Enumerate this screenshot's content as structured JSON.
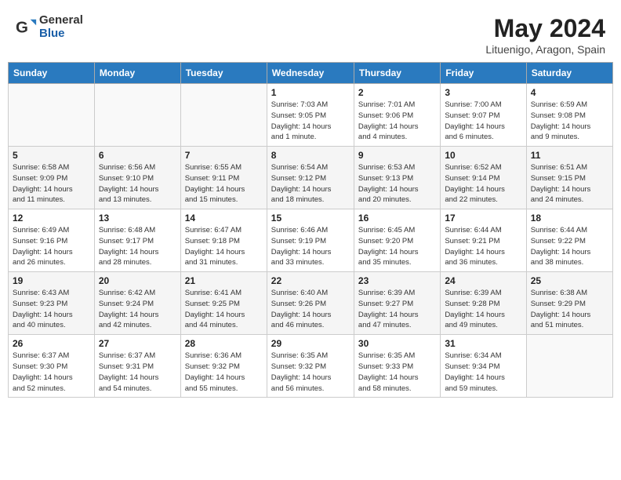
{
  "header": {
    "logo_general": "General",
    "logo_blue": "Blue",
    "title": "May 2024",
    "location": "Lituenigo, Aragon, Spain"
  },
  "weekdays": [
    "Sunday",
    "Monday",
    "Tuesday",
    "Wednesday",
    "Thursday",
    "Friday",
    "Saturday"
  ],
  "weeks": [
    [
      {
        "day": "",
        "info": ""
      },
      {
        "day": "",
        "info": ""
      },
      {
        "day": "",
        "info": ""
      },
      {
        "day": "1",
        "info": "Sunrise: 7:03 AM\nSunset: 9:05 PM\nDaylight: 14 hours\nand 1 minute."
      },
      {
        "day": "2",
        "info": "Sunrise: 7:01 AM\nSunset: 9:06 PM\nDaylight: 14 hours\nand 4 minutes."
      },
      {
        "day": "3",
        "info": "Sunrise: 7:00 AM\nSunset: 9:07 PM\nDaylight: 14 hours\nand 6 minutes."
      },
      {
        "day": "4",
        "info": "Sunrise: 6:59 AM\nSunset: 9:08 PM\nDaylight: 14 hours\nand 9 minutes."
      }
    ],
    [
      {
        "day": "5",
        "info": "Sunrise: 6:58 AM\nSunset: 9:09 PM\nDaylight: 14 hours\nand 11 minutes."
      },
      {
        "day": "6",
        "info": "Sunrise: 6:56 AM\nSunset: 9:10 PM\nDaylight: 14 hours\nand 13 minutes."
      },
      {
        "day": "7",
        "info": "Sunrise: 6:55 AM\nSunset: 9:11 PM\nDaylight: 14 hours\nand 15 minutes."
      },
      {
        "day": "8",
        "info": "Sunrise: 6:54 AM\nSunset: 9:12 PM\nDaylight: 14 hours\nand 18 minutes."
      },
      {
        "day": "9",
        "info": "Sunrise: 6:53 AM\nSunset: 9:13 PM\nDaylight: 14 hours\nand 20 minutes."
      },
      {
        "day": "10",
        "info": "Sunrise: 6:52 AM\nSunset: 9:14 PM\nDaylight: 14 hours\nand 22 minutes."
      },
      {
        "day": "11",
        "info": "Sunrise: 6:51 AM\nSunset: 9:15 PM\nDaylight: 14 hours\nand 24 minutes."
      }
    ],
    [
      {
        "day": "12",
        "info": "Sunrise: 6:49 AM\nSunset: 9:16 PM\nDaylight: 14 hours\nand 26 minutes."
      },
      {
        "day": "13",
        "info": "Sunrise: 6:48 AM\nSunset: 9:17 PM\nDaylight: 14 hours\nand 28 minutes."
      },
      {
        "day": "14",
        "info": "Sunrise: 6:47 AM\nSunset: 9:18 PM\nDaylight: 14 hours\nand 31 minutes."
      },
      {
        "day": "15",
        "info": "Sunrise: 6:46 AM\nSunset: 9:19 PM\nDaylight: 14 hours\nand 33 minutes."
      },
      {
        "day": "16",
        "info": "Sunrise: 6:45 AM\nSunset: 9:20 PM\nDaylight: 14 hours\nand 35 minutes."
      },
      {
        "day": "17",
        "info": "Sunrise: 6:44 AM\nSunset: 9:21 PM\nDaylight: 14 hours\nand 36 minutes."
      },
      {
        "day": "18",
        "info": "Sunrise: 6:44 AM\nSunset: 9:22 PM\nDaylight: 14 hours\nand 38 minutes."
      }
    ],
    [
      {
        "day": "19",
        "info": "Sunrise: 6:43 AM\nSunset: 9:23 PM\nDaylight: 14 hours\nand 40 minutes."
      },
      {
        "day": "20",
        "info": "Sunrise: 6:42 AM\nSunset: 9:24 PM\nDaylight: 14 hours\nand 42 minutes."
      },
      {
        "day": "21",
        "info": "Sunrise: 6:41 AM\nSunset: 9:25 PM\nDaylight: 14 hours\nand 44 minutes."
      },
      {
        "day": "22",
        "info": "Sunrise: 6:40 AM\nSunset: 9:26 PM\nDaylight: 14 hours\nand 46 minutes."
      },
      {
        "day": "23",
        "info": "Sunrise: 6:39 AM\nSunset: 9:27 PM\nDaylight: 14 hours\nand 47 minutes."
      },
      {
        "day": "24",
        "info": "Sunrise: 6:39 AM\nSunset: 9:28 PM\nDaylight: 14 hours\nand 49 minutes."
      },
      {
        "day": "25",
        "info": "Sunrise: 6:38 AM\nSunset: 9:29 PM\nDaylight: 14 hours\nand 51 minutes."
      }
    ],
    [
      {
        "day": "26",
        "info": "Sunrise: 6:37 AM\nSunset: 9:30 PM\nDaylight: 14 hours\nand 52 minutes."
      },
      {
        "day": "27",
        "info": "Sunrise: 6:37 AM\nSunset: 9:31 PM\nDaylight: 14 hours\nand 54 minutes."
      },
      {
        "day": "28",
        "info": "Sunrise: 6:36 AM\nSunset: 9:32 PM\nDaylight: 14 hours\nand 55 minutes."
      },
      {
        "day": "29",
        "info": "Sunrise: 6:35 AM\nSunset: 9:32 PM\nDaylight: 14 hours\nand 56 minutes."
      },
      {
        "day": "30",
        "info": "Sunrise: 6:35 AM\nSunset: 9:33 PM\nDaylight: 14 hours\nand 58 minutes."
      },
      {
        "day": "31",
        "info": "Sunrise: 6:34 AM\nSunset: 9:34 PM\nDaylight: 14 hours\nand 59 minutes."
      },
      {
        "day": "",
        "info": ""
      }
    ]
  ]
}
